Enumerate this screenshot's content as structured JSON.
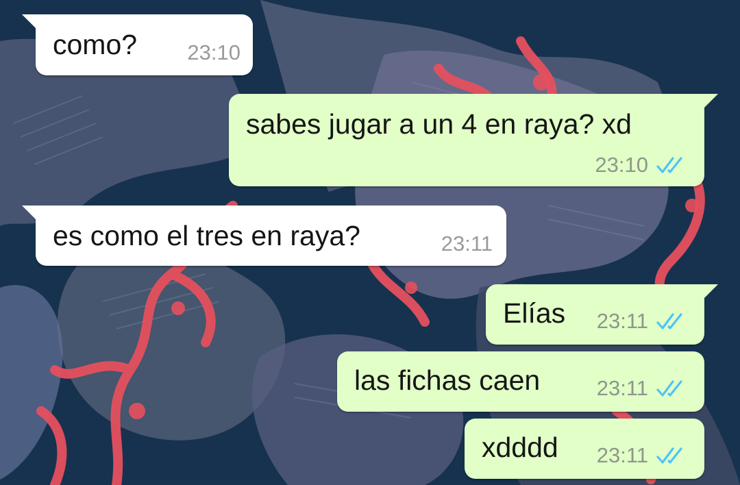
{
  "colors": {
    "incoming_bubble": "#ffffff",
    "outgoing_bubble": "#e1ffc7",
    "read_ticks": "#4fc3f7",
    "timestamp": "#8f968a"
  },
  "messages": [
    {
      "direction": "incoming",
      "text": "como?",
      "time": "23:10"
    },
    {
      "direction": "outgoing",
      "text": "sabes jugar a un 4 en raya? xd",
      "time": "23:10",
      "status": "read"
    },
    {
      "direction": "incoming",
      "text": "es como el tres en raya?",
      "time": "23:11"
    },
    {
      "direction": "outgoing",
      "text": "Elías",
      "time": "23:11",
      "status": "read"
    },
    {
      "direction": "outgoing",
      "text": "las fichas caen",
      "time": "23:11",
      "status": "read"
    },
    {
      "direction": "outgoing",
      "text": "xdddd",
      "time": "23:11",
      "status": "read"
    }
  ]
}
